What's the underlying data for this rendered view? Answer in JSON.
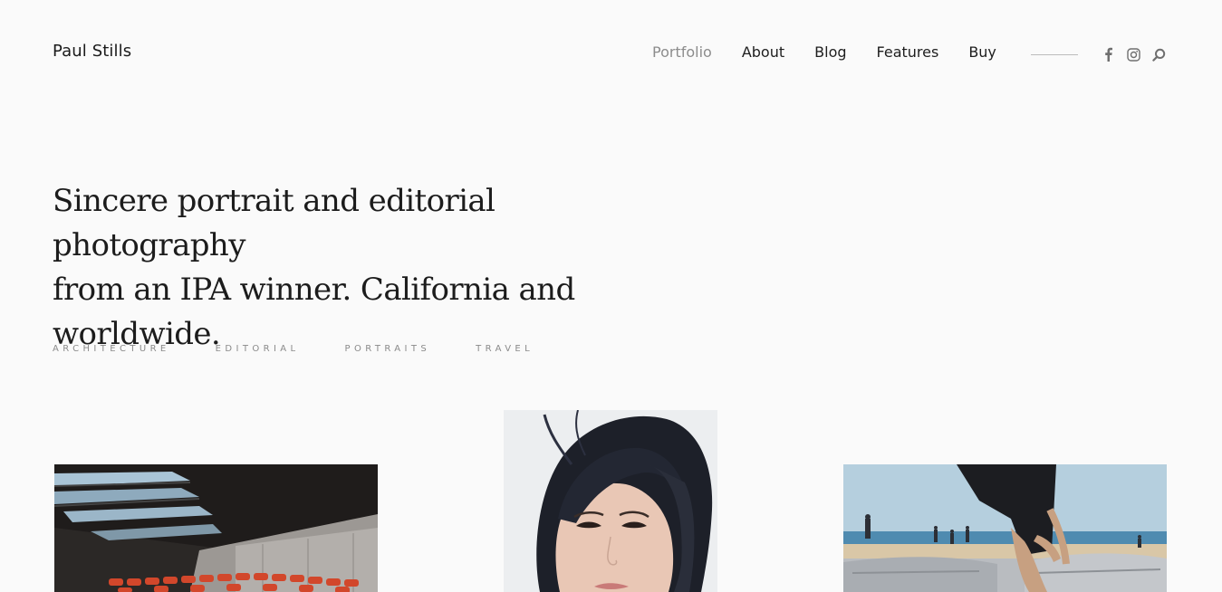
{
  "site": {
    "logo": "Paul Stills"
  },
  "nav": {
    "items": [
      {
        "label": "Portfolio",
        "active": true
      },
      {
        "label": "About",
        "active": false
      },
      {
        "label": "Blog",
        "active": false
      },
      {
        "label": "Features",
        "active": false
      },
      {
        "label": "Buy",
        "active": false
      }
    ]
  },
  "social": {
    "icons": [
      "facebook-icon",
      "instagram-icon",
      "search-icon"
    ],
    "icon_color": "#6f6f6f"
  },
  "hero": {
    "line1": "Sincere portrait and editorial photography",
    "line2": "from an IPA winner. California and",
    "line3": "worldwide."
  },
  "filters": [
    "ARCHITECTURE",
    "EDITORIAL",
    "PORTRAITS",
    "TRAVEL"
  ],
  "gallery": [
    {
      "subject": "architecture interior with red seats"
    },
    {
      "subject": "portrait of woman with dark hair"
    },
    {
      "subject": "skateboarder at beach skatepark"
    }
  ],
  "colors": {
    "background": "#fafafa",
    "text": "#1c1c1c",
    "muted": "#8a8a8a",
    "active_nav": "#8c8c8c"
  }
}
